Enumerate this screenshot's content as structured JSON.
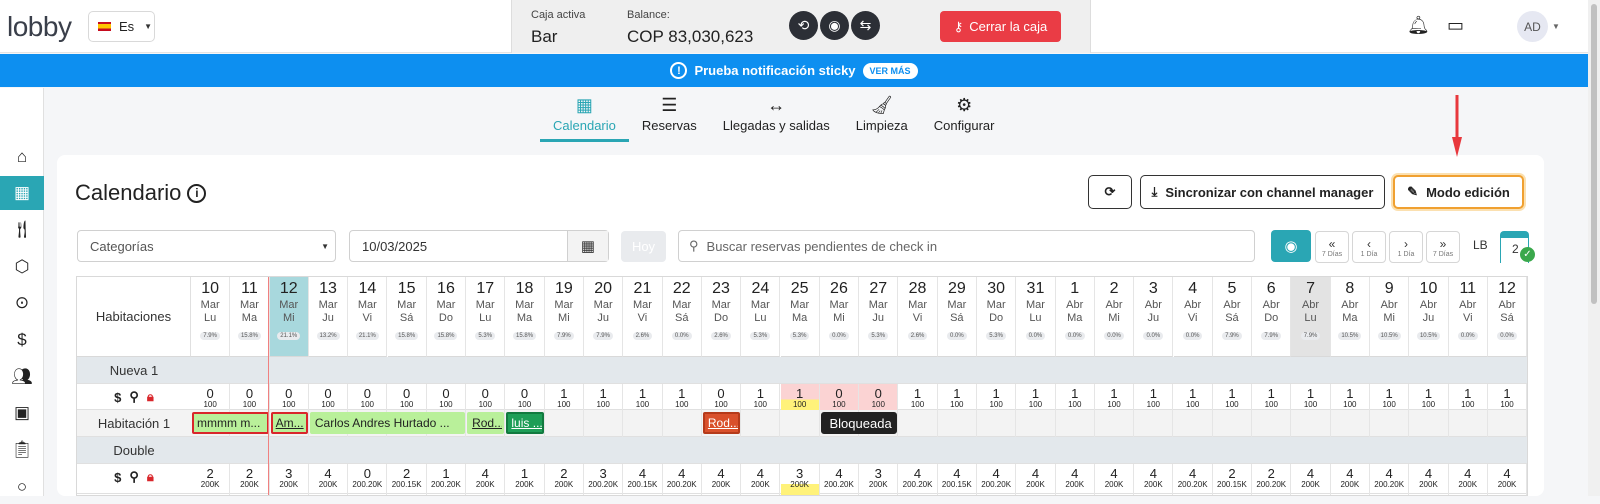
{
  "header": {
    "logo": "lobby",
    "language": "Es",
    "caja_label": "Caja activa",
    "caja_value": "Bar",
    "balance_label": "Balance:",
    "balance_value": "COP 83,030,623",
    "close_button": "Cerrar la caja",
    "avatar": "AD"
  },
  "banner": {
    "text": "Prueba notificación sticky",
    "more": "VER MÁS"
  },
  "tabs": [
    {
      "label": "Calendario",
      "icon": "calendar-icon"
    },
    {
      "label": "Reservas",
      "icon": "list-icon"
    },
    {
      "label": "Llegadas y salidas",
      "icon": "arrows-icon"
    },
    {
      "label": "Limpieza",
      "icon": "broom-icon"
    },
    {
      "label": "Configurar",
      "icon": "gear-icon"
    }
  ],
  "page": {
    "title": "Calendario",
    "sync_button": "Sincronizar con channel manager",
    "edit_button": "Modo edición"
  },
  "filters": {
    "category": "Categorías",
    "date": "10/03/2025",
    "today": "Hoy",
    "search_placeholder": "Buscar reservas pendientes de check in",
    "nav": [
      {
        "label": "7 Días"
      },
      {
        "label": "1 Día"
      },
      {
        "label": "1 Día"
      },
      {
        "label": "7 Días"
      }
    ],
    "lb": "LB",
    "count": "2"
  },
  "grid": {
    "rooms_header": "Habitaciones",
    "days": [
      {
        "n": "10",
        "m": "Mar",
        "w": "Lu",
        "p": "7.9%"
      },
      {
        "n": "11",
        "m": "Mar",
        "w": "Ma",
        "p": "15.8%"
      },
      {
        "n": "12",
        "m": "Mar",
        "w": "Mi",
        "p": "21.1%"
      },
      {
        "n": "13",
        "m": "Mar",
        "w": "Ju",
        "p": "13.2%"
      },
      {
        "n": "14",
        "m": "Mar",
        "w": "Vi",
        "p": "21.1%"
      },
      {
        "n": "15",
        "m": "Mar",
        "w": "Sá",
        "p": "15.8%"
      },
      {
        "n": "16",
        "m": "Mar",
        "w": "Do",
        "p": "15.8%"
      },
      {
        "n": "17",
        "m": "Mar",
        "w": "Lu",
        "p": "5.3%"
      },
      {
        "n": "18",
        "m": "Mar",
        "w": "Ma",
        "p": "15.8%"
      },
      {
        "n": "19",
        "m": "Mar",
        "w": "Mi",
        "p": "7.9%"
      },
      {
        "n": "20",
        "m": "Mar",
        "w": "Ju",
        "p": "7.9%"
      },
      {
        "n": "21",
        "m": "Mar",
        "w": "Vi",
        "p": "2.6%"
      },
      {
        "n": "22",
        "m": "Mar",
        "w": "Sá",
        "p": "0.0%"
      },
      {
        "n": "23",
        "m": "Mar",
        "w": "Do",
        "p": "2.6%"
      },
      {
        "n": "24",
        "m": "Mar",
        "w": "Lu",
        "p": "5.3%"
      },
      {
        "n": "25",
        "m": "Mar",
        "w": "Ma",
        "p": "5.3%"
      },
      {
        "n": "26",
        "m": "Mar",
        "w": "Mi",
        "p": "0.0%"
      },
      {
        "n": "27",
        "m": "Mar",
        "w": "Ju",
        "p": "5.3%"
      },
      {
        "n": "28",
        "m": "Mar",
        "w": "Vi",
        "p": "2.6%"
      },
      {
        "n": "29",
        "m": "Mar",
        "w": "Sá",
        "p": "0.0%"
      },
      {
        "n": "30",
        "m": "Mar",
        "w": "Do",
        "p": "5.3%"
      },
      {
        "n": "31",
        "m": "Mar",
        "w": "Lu",
        "p": "0.0%"
      },
      {
        "n": "1",
        "m": "Abr",
        "w": "Ma",
        "p": "0.0%"
      },
      {
        "n": "2",
        "m": "Abr",
        "w": "Mi",
        "p": "0.0%"
      },
      {
        "n": "3",
        "m": "Abr",
        "w": "Ju",
        "p": "0.0%"
      },
      {
        "n": "4",
        "m": "Abr",
        "w": "Vi",
        "p": "0.0%"
      },
      {
        "n": "5",
        "m": "Abr",
        "w": "Sá",
        "p": "7.9%"
      },
      {
        "n": "6",
        "m": "Abr",
        "w": "Do",
        "p": "7.9%"
      },
      {
        "n": "7",
        "m": "Abr",
        "w": "Lu",
        "p": "7.9%"
      },
      {
        "n": "8",
        "m": "Abr",
        "w": "Ma",
        "p": "10.5%"
      },
      {
        "n": "9",
        "m": "Abr",
        "w": "Mi",
        "p": "10.5%"
      },
      {
        "n": "10",
        "m": "Abr",
        "w": "Ju",
        "p": "10.5%"
      },
      {
        "n": "11",
        "m": "Abr",
        "w": "Vi",
        "p": "0.0%"
      },
      {
        "n": "12",
        "m": "Abr",
        "w": "Sá",
        "p": "0.0%"
      }
    ],
    "group1": "Nueva 1",
    "avail1": [
      "0",
      "0",
      "0",
      "0",
      "0",
      "0",
      "0",
      "0",
      "0",
      "1",
      "1",
      "1",
      "1",
      "0",
      "1",
      "1",
      "0",
      "0",
      "1",
      "1",
      "1",
      "1",
      "1",
      "1",
      "1",
      "1",
      "1",
      "1",
      "1",
      "1",
      "1",
      "1",
      "1",
      "1"
    ],
    "price1": "100",
    "room1": "Habitación 1",
    "bookings": [
      {
        "text": "mmmm m...",
        "start": 0,
        "span": 2,
        "bg": "#b9f09a",
        "border": "#d9262b",
        "underline": false
      },
      {
        "text": "Am...",
        "start": 2,
        "span": 1,
        "bg": "#b9f09a",
        "border": "#d9262b",
        "underline": true
      },
      {
        "text": "Carlos Andres Hurtado ...",
        "start": 3,
        "span": 4,
        "bg": "#b9f09a",
        "border": "#b9f09a",
        "underline": false
      },
      {
        "text": "Rod...",
        "start": 7,
        "span": 1,
        "bg": "#b9f09a",
        "border": "#b9f09a",
        "underline": true
      },
      {
        "text": "luis ...",
        "start": 8,
        "span": 1,
        "bg": "#1e9e57",
        "border": "#127a3f",
        "underline": true,
        "color": "#fff"
      },
      {
        "text": "Rod...",
        "start": 13,
        "span": 1,
        "bg": "#d9502b",
        "border": "#b53a1a",
        "underline": true,
        "color": "#fff"
      },
      {
        "text": "Bloqueada",
        "start": 16,
        "span": 2,
        "bg": "#222222",
        "border": "#222222",
        "underline": false,
        "color": "#fff"
      }
    ],
    "group2": "Double",
    "avail2": [
      "2",
      "2",
      "3",
      "4",
      "0",
      "2",
      "1",
      "4",
      "1",
      "2",
      "3",
      "4",
      "4",
      "4",
      "4",
      "3",
      "4",
      "3",
      "4",
      "4",
      "4",
      "4",
      "4",
      "4",
      "4",
      "4",
      "2",
      "2",
      "4",
      "4",
      "4",
      "4",
      "4",
      "4"
    ],
    "price2": [
      "200K",
      "200K",
      "200K",
      "200K",
      "200.20K",
      "200.15K",
      "200.20K",
      "200K",
      "200K",
      "200K",
      "200.20K",
      "200.15K",
      "200.20K",
      "200K",
      "200K",
      "200K",
      "200.20K",
      "200K",
      "200.20K",
      "200.15K",
      "200.20K",
      "200K",
      "200K",
      "200K",
      "200K",
      "200.20K",
      "200.15K",
      "200.20K",
      "200K",
      "200K",
      "200.20K",
      "200K",
      "200K",
      "200K"
    ]
  }
}
